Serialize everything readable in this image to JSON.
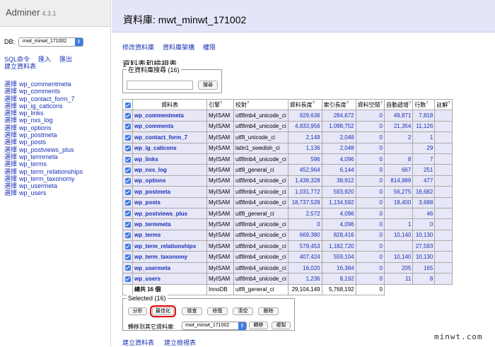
{
  "app": {
    "name": "Adminer",
    "version": "4.3.1"
  },
  "sidebar": {
    "db_label": "DB:",
    "db_value": "mwt_minwt_171002",
    "links": [
      "SQL命令",
      "匯入",
      "匯出",
      "建立資料表"
    ],
    "select_prefix": "選擇",
    "tables": [
      "wp_commentmeta",
      "wp_comments",
      "wp_contact_form_7",
      "wp_ig_caticons",
      "wp_links",
      "wp_nxs_log",
      "wp_options",
      "wp_postmeta",
      "wp_posts",
      "wp_postviews_plus",
      "wp_termmeta",
      "wp_terms",
      "wp_term_relationships",
      "wp_term_taxonomy",
      "wp_usermeta",
      "wp_users"
    ]
  },
  "main": {
    "title": "資料庫: mwt_minwt_171002",
    "links": [
      "修改資料庫",
      "資料庫架構",
      "權限"
    ],
    "section_title": "資料表和檢視表",
    "search_legend": "在資料庫搜尋 (16)",
    "search_placeholder": "",
    "search_button": "搜尋",
    "columns": [
      "資料表",
      "引擎",
      "校對",
      "資料長度",
      "索引長度",
      "資料空閒",
      "自動遞增",
      "行數",
      "註解"
    ],
    "rows": [
      [
        "wp_commentmeta",
        "MyISAM",
        "utf8mb4_unicode_ci",
        "929,636",
        "284,672",
        "0",
        "49,871",
        "7,818",
        ""
      ],
      [
        "wp_comments",
        "MyISAM",
        "utf8mb4_unicode_ci",
        "4,833,956",
        "1,098,752",
        "0",
        "21,354",
        "11,126",
        ""
      ],
      [
        "wp_contact_form_7",
        "MyISAM",
        "utf8_unicode_ci",
        "2,148",
        "2,048",
        "0",
        "2",
        "1",
        ""
      ],
      [
        "wp_ig_caticons",
        "MyISAM",
        "latin1_swedish_ci",
        "1,136",
        "2,048",
        "0",
        "",
        "29",
        ""
      ],
      [
        "wp_links",
        "MyISAM",
        "utf8mb4_unicode_ci",
        "596",
        "4,096",
        "0",
        "8",
        "7",
        ""
      ],
      [
        "wp_nxs_log",
        "MyISAM",
        "utf8_general_ci",
        "452,964",
        "6,144",
        "0",
        "667",
        "251",
        ""
      ],
      [
        "wp_options",
        "MyISAM",
        "utf8mb4_unicode_ci",
        "1,438,328",
        "38,912",
        "0",
        "814,989",
        "477",
        ""
      ],
      [
        "wp_postmeta",
        "MyISAM",
        "utf8mb4_unicode_ci",
        "1,031,772",
        "593,920",
        "0",
        "56,275",
        "16,682",
        ""
      ],
      [
        "wp_posts",
        "MyISAM",
        "utf8mb4_unicode_ci",
        "18,737,528",
        "1,134,592",
        "0",
        "18,400",
        "3,688",
        ""
      ],
      [
        "wp_postviews_plus",
        "MyISAM",
        "utf8_general_ci",
        "2,572",
        "4,096",
        "0",
        "",
        "46",
        ""
      ],
      [
        "wp_termmeta",
        "MyISAM",
        "utf8mb4_unicode_ci",
        "0",
        "4,096",
        "0",
        "1",
        "0",
        ""
      ],
      [
        "wp_terms",
        "MyISAM",
        "utf8mb4_unicode_ci",
        "669,380",
        "828,416",
        "0",
        "10,140",
        "10,130",
        ""
      ],
      [
        "wp_term_relationships",
        "MyISAM",
        "utf8mb4_unicode_ci",
        "579,453",
        "1,182,720",
        "0",
        "",
        "27,593",
        ""
      ],
      [
        "wp_term_taxonomy",
        "MyISAM",
        "utf8mb4_unicode_ci",
        "407,424",
        "559,104",
        "0",
        "10,140",
        "10,130",
        ""
      ],
      [
        "wp_usermeta",
        "MyISAM",
        "utf8mb4_unicode_ci",
        "16,020",
        "16,384",
        "0",
        "205",
        "165",
        ""
      ],
      [
        "wp_users",
        "MyISAM",
        "utf8mb4_unicode_ci",
        "1,236",
        "8,192",
        "0",
        "11",
        "8",
        ""
      ]
    ],
    "total": {
      "label": "總共 16 個",
      "engine": "InnoDB",
      "collation": "utf8_general_ci",
      "data": "29,104,149",
      "index": "5,768,192",
      "free": "0"
    },
    "selected_legend": "Selected (16)",
    "actions": [
      "分析",
      "最佳化",
      "檢查",
      "修復",
      "清空",
      "刪除"
    ],
    "move_label": "轉移到其它資料庫:",
    "move_db": "mwt_minwt_171002",
    "move_button": "轉移",
    "copy_button": "複製",
    "bottom_links": [
      "建立資料表",
      "建立檢視表"
    ]
  },
  "watermark": "minwt.com",
  "colors": {
    "accent": "#1a31b5",
    "header_bg": "#e5e5fa",
    "row_bg": "#e7e7f7",
    "checkbox": "#3d7be6",
    "highlight": "#e00000"
  }
}
